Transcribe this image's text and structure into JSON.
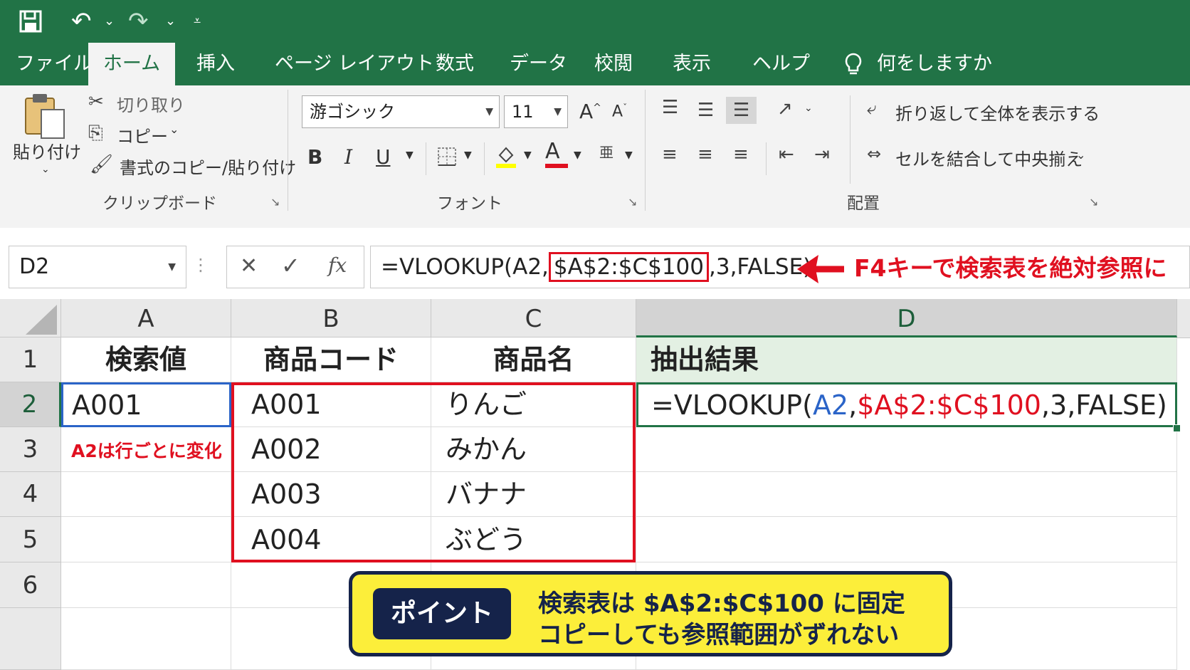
{
  "quick_access": {
    "save_icon": "save-icon",
    "undo_icon": "undo-icon",
    "redo_icon": "redo-icon",
    "customize_icon": "customize-quick-access-icon"
  },
  "tabs": [
    {
      "label": "ファイル",
      "active": false
    },
    {
      "label": "ホーム",
      "active": true
    },
    {
      "label": "挿入",
      "active": false
    },
    {
      "label": "ページ レイアウト",
      "active": false
    },
    {
      "label": "数式",
      "active": false
    },
    {
      "label": "データ",
      "active": false
    },
    {
      "label": "校閲",
      "active": false
    },
    {
      "label": "表示",
      "active": false
    },
    {
      "label": "ヘルプ",
      "active": false
    }
  ],
  "tell_me": "何をしますか",
  "ribbon": {
    "clipboard": {
      "paste": "貼り付け",
      "cut": "切り取り",
      "copy": "コピー",
      "format_painter": "書式のコピー/貼り付け",
      "group_label": "クリップボード"
    },
    "font": {
      "font_name": "游ゴシック",
      "font_size": "11",
      "bold": "B",
      "italic": "I",
      "underline": "U",
      "font_color_letter": "A",
      "grow": "A",
      "shrink": "A",
      "group_label": "フォント",
      "highlight_color": "#ffff00",
      "font_color": "#e01020"
    },
    "alignment": {
      "wrap_text": "折り返して全体を表示する",
      "merge_center": "セルを結合して中央揃え",
      "group_label": "配置"
    }
  },
  "formula_bar": {
    "name_box": "D2",
    "cancel": "✕",
    "enter": "✓",
    "fx": "fx",
    "formula_pre": "=VLOOKUP(A2,",
    "formula_highlight": "$A$2:$C$100",
    "formula_post": ",3,FALSE)",
    "callout": "F4キーで検索表を絶対参照に"
  },
  "columns": [
    "A",
    "B",
    "C",
    "D"
  ],
  "rows": [
    "1",
    "2",
    "3",
    "4",
    "5",
    "6"
  ],
  "headers": {
    "a": "検索値",
    "b": "商品コード",
    "c": "商品名",
    "d": "抽出結果"
  },
  "cells": {
    "a2": "A001",
    "b": [
      "A001",
      "A002",
      "A003",
      "A004"
    ],
    "c": [
      "りんご",
      "みかん",
      "バナナ",
      "ぶどう"
    ]
  },
  "d2_formula": {
    "p1": "=VLOOKUP(",
    "p2": "A2",
    "p3": ",",
    "p4": "$A$2:$C$100",
    "p5": ",3,FALSE)"
  },
  "note_a3": "A2は行ごとに変化",
  "point_box": {
    "label": "ポイント",
    "line1": "検索表は $A$2:$C$100 に固定",
    "line2": "コピーしても参照範囲がずれない"
  },
  "colors": {
    "excel_green": "#217346",
    "highlight_red": "#e01020",
    "ref_blue": "#2b64c8",
    "point_yellow": "#fcee3a",
    "point_navy": "#15234a"
  }
}
